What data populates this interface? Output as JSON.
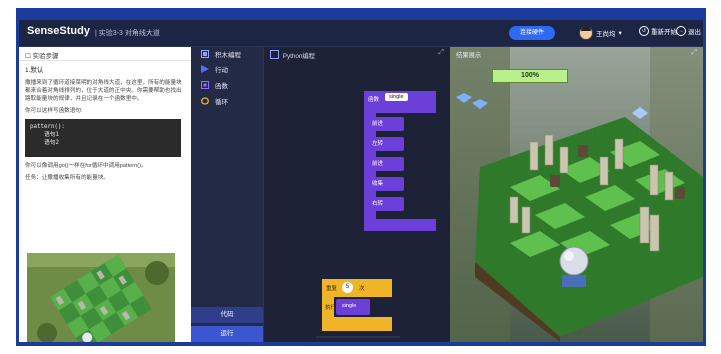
{
  "app": {
    "logo": "SenseStudy",
    "breadcrumb": "| 实验3-3 对角线大道",
    "connect_label": "连接硬件",
    "user_name": "王尚均",
    "restart_label": "重新开始",
    "exit_label": "退出"
  },
  "left_panel": {
    "header": "实验步骤",
    "section_title": "1.默认",
    "paragraph1": "撒播来到了循环道接菜明的对角线大道，在这里，所有的能量块都来合着对角线排列的，位于大道的正中央。你需要帮助也找出路取能量块的规律，并且记录在一个函数里中。",
    "paragraph2": "你可以这样写函数语句:",
    "code_lines": [
      "pattern():",
      "    语句1",
      "    语句2"
    ],
    "paragraph3": "你可以像调用go()一样在for循环中调用pattern()。",
    "paragraph4": "任务：让撒播收集所有的能量块。"
  },
  "nav": {
    "header": "积木编程",
    "items": [
      {
        "label": "行动",
        "color": "#5b6cf5"
      },
      {
        "label": "函数",
        "color": "#6b3fd8"
      },
      {
        "label": "循环",
        "color": "#f0b428"
      }
    ],
    "bottom_code": "代码",
    "bottom_run": "运行"
  },
  "canvas": {
    "header": "Python编程",
    "function_keyword": "函数",
    "function_name": "single",
    "statements": [
      "前进",
      "左转",
      "前进",
      "收集",
      "右转"
    ],
    "loop_keyword": "重复",
    "loop_count": "5",
    "loop_suffix": "次",
    "loop_exec": "执行",
    "call_name": "single",
    "zoom_in": "+",
    "zoom_out": "−",
    "reset": "◎"
  },
  "scene": {
    "header": "结果展示",
    "progress_text": "100%",
    "progress_value": 1.0
  },
  "colors": {
    "frame_blue": "#1b3c9a",
    "function_purple": "#6b3fd8",
    "loop_yellow": "#f0b428",
    "action_blue": "#5b6cf5",
    "progress_green": "#b9f08b"
  }
}
